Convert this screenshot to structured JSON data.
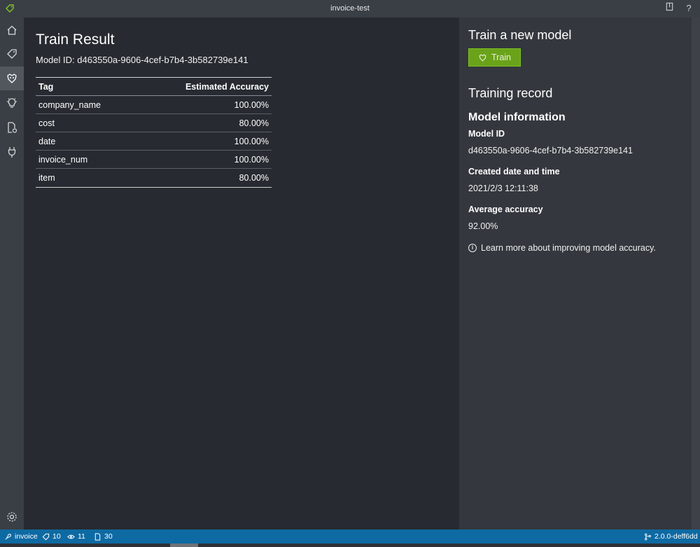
{
  "window": {
    "title": "invoice-test"
  },
  "main": {
    "title": "Train Result",
    "model_id_line": "Model ID: d463550a-9606-4cef-b7b4-3b582739e141",
    "table": {
      "headers": [
        "Tag",
        "Estimated Accuracy"
      ],
      "rows": [
        [
          "company_name",
          "100.00%"
        ],
        [
          "cost",
          "80.00%"
        ],
        [
          "date",
          "100.00%"
        ],
        [
          "invoice_num",
          "100.00%"
        ],
        [
          "item",
          "80.00%"
        ]
      ]
    }
  },
  "right": {
    "train_heading": "Train a new model",
    "train_button": "Train",
    "training_record": "Training record",
    "model_information": "Model information",
    "model_id_label": "Model ID",
    "model_id_value": "d463550a-9606-4cef-b7b4-3b582739e141",
    "created_label": "Created date and time",
    "created_value": "2021/2/3 12:11:38",
    "avg_label": "Average accuracy",
    "avg_value": "92.00%",
    "learn_more": "Learn more about improving model accuracy."
  },
  "statusbar": {
    "project": "invoice",
    "tags": "10",
    "visited": "11",
    "files": "30",
    "version": "2.0.0-deff6dd"
  },
  "colors": {
    "accent_green": "#6aa31a",
    "statusbar_blue": "#0e6aa3",
    "main_bg": "#272b31",
    "panel_bg": "#34383e"
  },
  "icons": {
    "app": "tag-logo-icon",
    "nav": [
      "home-icon",
      "tag-icon",
      "train-icon",
      "lightbulb-icon",
      "document-settings-icon",
      "plug-icon",
      "gear-icon"
    ]
  }
}
